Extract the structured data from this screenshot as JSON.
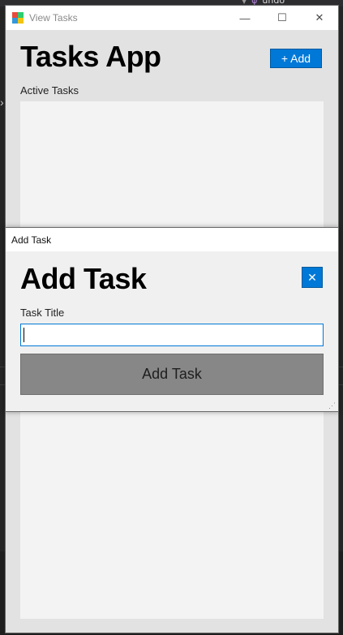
{
  "background": {
    "editor_token": "undo"
  },
  "main_window": {
    "title": "View Tasks",
    "controls": {
      "minimize": "—",
      "maximize": "☐",
      "close": "✕"
    },
    "heading": "Tasks App",
    "add_button_label": "+ Add",
    "section_label": "Active Tasks",
    "tasks": []
  },
  "dialog": {
    "title": "Add Task",
    "heading": "Add Task",
    "close_glyph": "✕",
    "field_label": "Task Title",
    "field_value": "",
    "submit_label": "Add Task"
  },
  "colors": {
    "accent": "#0078d7",
    "submit_disabled": "#878787"
  },
  "icons": {
    "app": "app-icon",
    "minimize": "minimize-icon",
    "maximize": "maximize-icon",
    "close": "close-icon",
    "dialog_close": "close-icon"
  }
}
